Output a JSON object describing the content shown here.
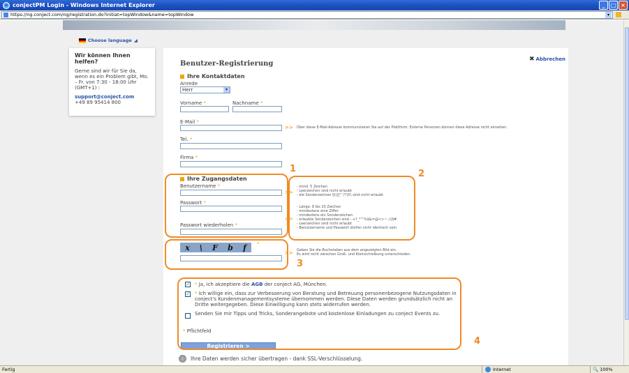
{
  "window": {
    "title": "conjectPM Login - Windows Internet Explorer",
    "url": "https://ng.conject.com/ng/registration.do?initiat=topWindow&name=topWindow"
  },
  "language": {
    "label": "Choose language"
  },
  "help": {
    "title": "Wir können Ihnen helfen?",
    "text": "Gerne sind wir für Sie da, wenn es ein Problem gibt, Mo. – Fr. von 7:30 - 18:00 Uhr (GMT+1) :",
    "email": "support@conject.com",
    "phone": "+49 89 95414 800"
  },
  "form": {
    "title": "Benutzer-Registrierung",
    "abort_label": "Abbrechen",
    "contact_section": "Ihre Kontaktdaten",
    "salutation_label": "Anrede",
    "salutation_value": "Herr",
    "firstname_label": "Vorname",
    "lastname_label": "Nachname",
    "email_label": "E-Mail",
    "email_hint": "Über diese E-Mail-Adresse kommunizieren Sie auf der Plattform. Externe Personen können diese Adresse nicht einsehen.",
    "phone_label": "Tel.",
    "company_label": "Firma",
    "access_section": "Ihre Zugangsdaten",
    "username_label": "Benutzername",
    "username_hints": [
      "- mind. 5 Zeichen",
      "- Leerzeichen sind nicht erlaubt",
      "- die Sonderzeichen §()[]\"´/?'|€\\ sind nicht erlaubt"
    ],
    "password_label": "Passwort",
    "password_hints": [
      "- Länge: 8 bis 20 Zeichen",
      "- mindestens eine Ziffer",
      "- mindestens ein Sonderzeichen",
      "- erlaubte Sonderzeichen sind -.+?_*^%$&=@<>~.:()§#",
      "- Leerzeichen sind nicht erlaubt",
      "- Benutzername und Passwort dürfen nicht identisch sein"
    ],
    "password_repeat_label": "Passwort wiederholen",
    "captcha_chars": [
      "x",
      "\\",
      "F",
      "b",
      "f"
    ],
    "captcha_hints": [
      "Geben Sie die Buchstaben aus dem angezeigten Bild ein.",
      "Es wird nicht zwischen Groß- und Kleinschreibung unterschieden."
    ],
    "agb_prefix": "Ja, ich akzeptiere die",
    "agb_link": "AGB",
    "agb_suffix": "der conject AG, München.",
    "consent_text": "Ich willige ein, dass zur Verbesserung von Beratung und Betreuung personenbezogene Nutzungsdaten in conject's Kundenmanagementsysteme übernommen werden. Diese Daten werden grundsätzlich nicht an Dritte weitergegeben. Diese Einwilligung kann stets widerrufen werden.",
    "newsletter_text": "Senden Sie mir Tipps und Tricks, Sonderangebote und kostenlose Einladungen zu conject Events zu.",
    "required_label": "Pflichtfeld",
    "submit_label": "Registrieren >",
    "ssl_text": "Ihre Daten werden sicher übertragen - dank SSL-Verschlüsselung.",
    "required_marker": "*",
    "hint_arrow": ">>"
  },
  "annotations": {
    "n1": "1",
    "n2": "2",
    "n3": "3",
    "n4": "4"
  },
  "status": {
    "left": "Fertig",
    "zone": "Internet",
    "zoom": "100%"
  },
  "colors": {
    "accent": "#f08a24",
    "link": "#2a52a8"
  }
}
